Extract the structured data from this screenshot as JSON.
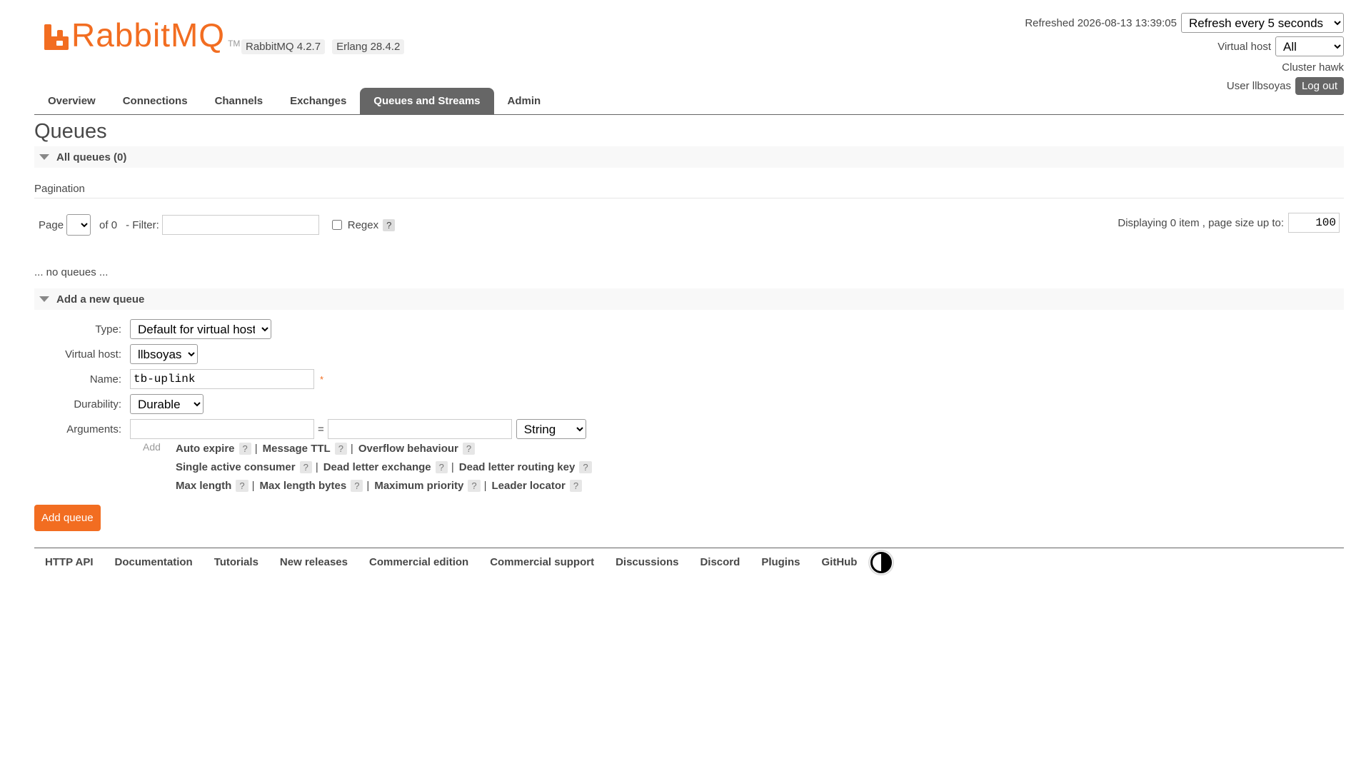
{
  "header": {
    "logo_text": "RabbitMQ",
    "logo_tm": "TM",
    "rabbitmq_version": "RabbitMQ 4.2.7",
    "erlang_version": "Erlang 28.4.2",
    "refreshed_label": "Refreshed 2026-08-13 13:39:05",
    "refresh_selected": "Refresh every 5 seconds",
    "virtual_host_label": "Virtual host",
    "virtual_host_selected": "All",
    "cluster_label": "Cluster hawk",
    "user_label": "User llbsoyas",
    "logout_label": "Log out"
  },
  "tabs": [
    {
      "label": "Overview"
    },
    {
      "label": "Connections"
    },
    {
      "label": "Channels"
    },
    {
      "label": "Exchanges"
    },
    {
      "label": "Queues and Streams",
      "active": true
    },
    {
      "label": "Admin"
    }
  ],
  "page": {
    "title": "Queues",
    "all_queues_label": "All queues (0)"
  },
  "pagination": {
    "heading": "Pagination",
    "page_label": "Page",
    "of_label": "of 0",
    "filter_label": "- Filter:",
    "filter_value": "",
    "regex_label": "Regex",
    "help": "?",
    "displaying_label": "Displaying 0 item , page size up to:",
    "page_size_value": "100"
  },
  "empty_message": "... no queues ...",
  "add_queue": {
    "section_label": "Add a new queue",
    "type_label": "Type:",
    "type_selected": "Default for virtual host",
    "vhost_label": "Virtual host:",
    "vhost_selected": "llbsoyas",
    "name_label": "Name:",
    "name_value": "tb-uplink",
    "required_mark": "*",
    "durability_label": "Durability:",
    "durability_selected": "Durable",
    "arguments_label": "Arguments:",
    "arg_equals": "=",
    "arg_type_selected": "String",
    "add_label": "Add",
    "hints_row1": [
      "Auto expire",
      "Message TTL",
      "Overflow behaviour"
    ],
    "hints_row2": [
      "Single active consumer",
      "Dead letter exchange",
      "Dead letter routing key"
    ],
    "hints_row3": [
      "Max length",
      "Max length bytes",
      "Maximum priority",
      "Leader locator"
    ],
    "hint_help": "?",
    "separator": "|",
    "submit_label": "Add queue"
  },
  "footer": {
    "links": [
      "HTTP API",
      "Documentation",
      "Tutorials",
      "New releases",
      "Commercial edition",
      "Commercial support",
      "Discussions",
      "Discord",
      "Plugins",
      "GitHub"
    ]
  },
  "colors": {
    "accent": "#f26d21",
    "tab_active_bg": "#666666",
    "text": "#484848"
  }
}
